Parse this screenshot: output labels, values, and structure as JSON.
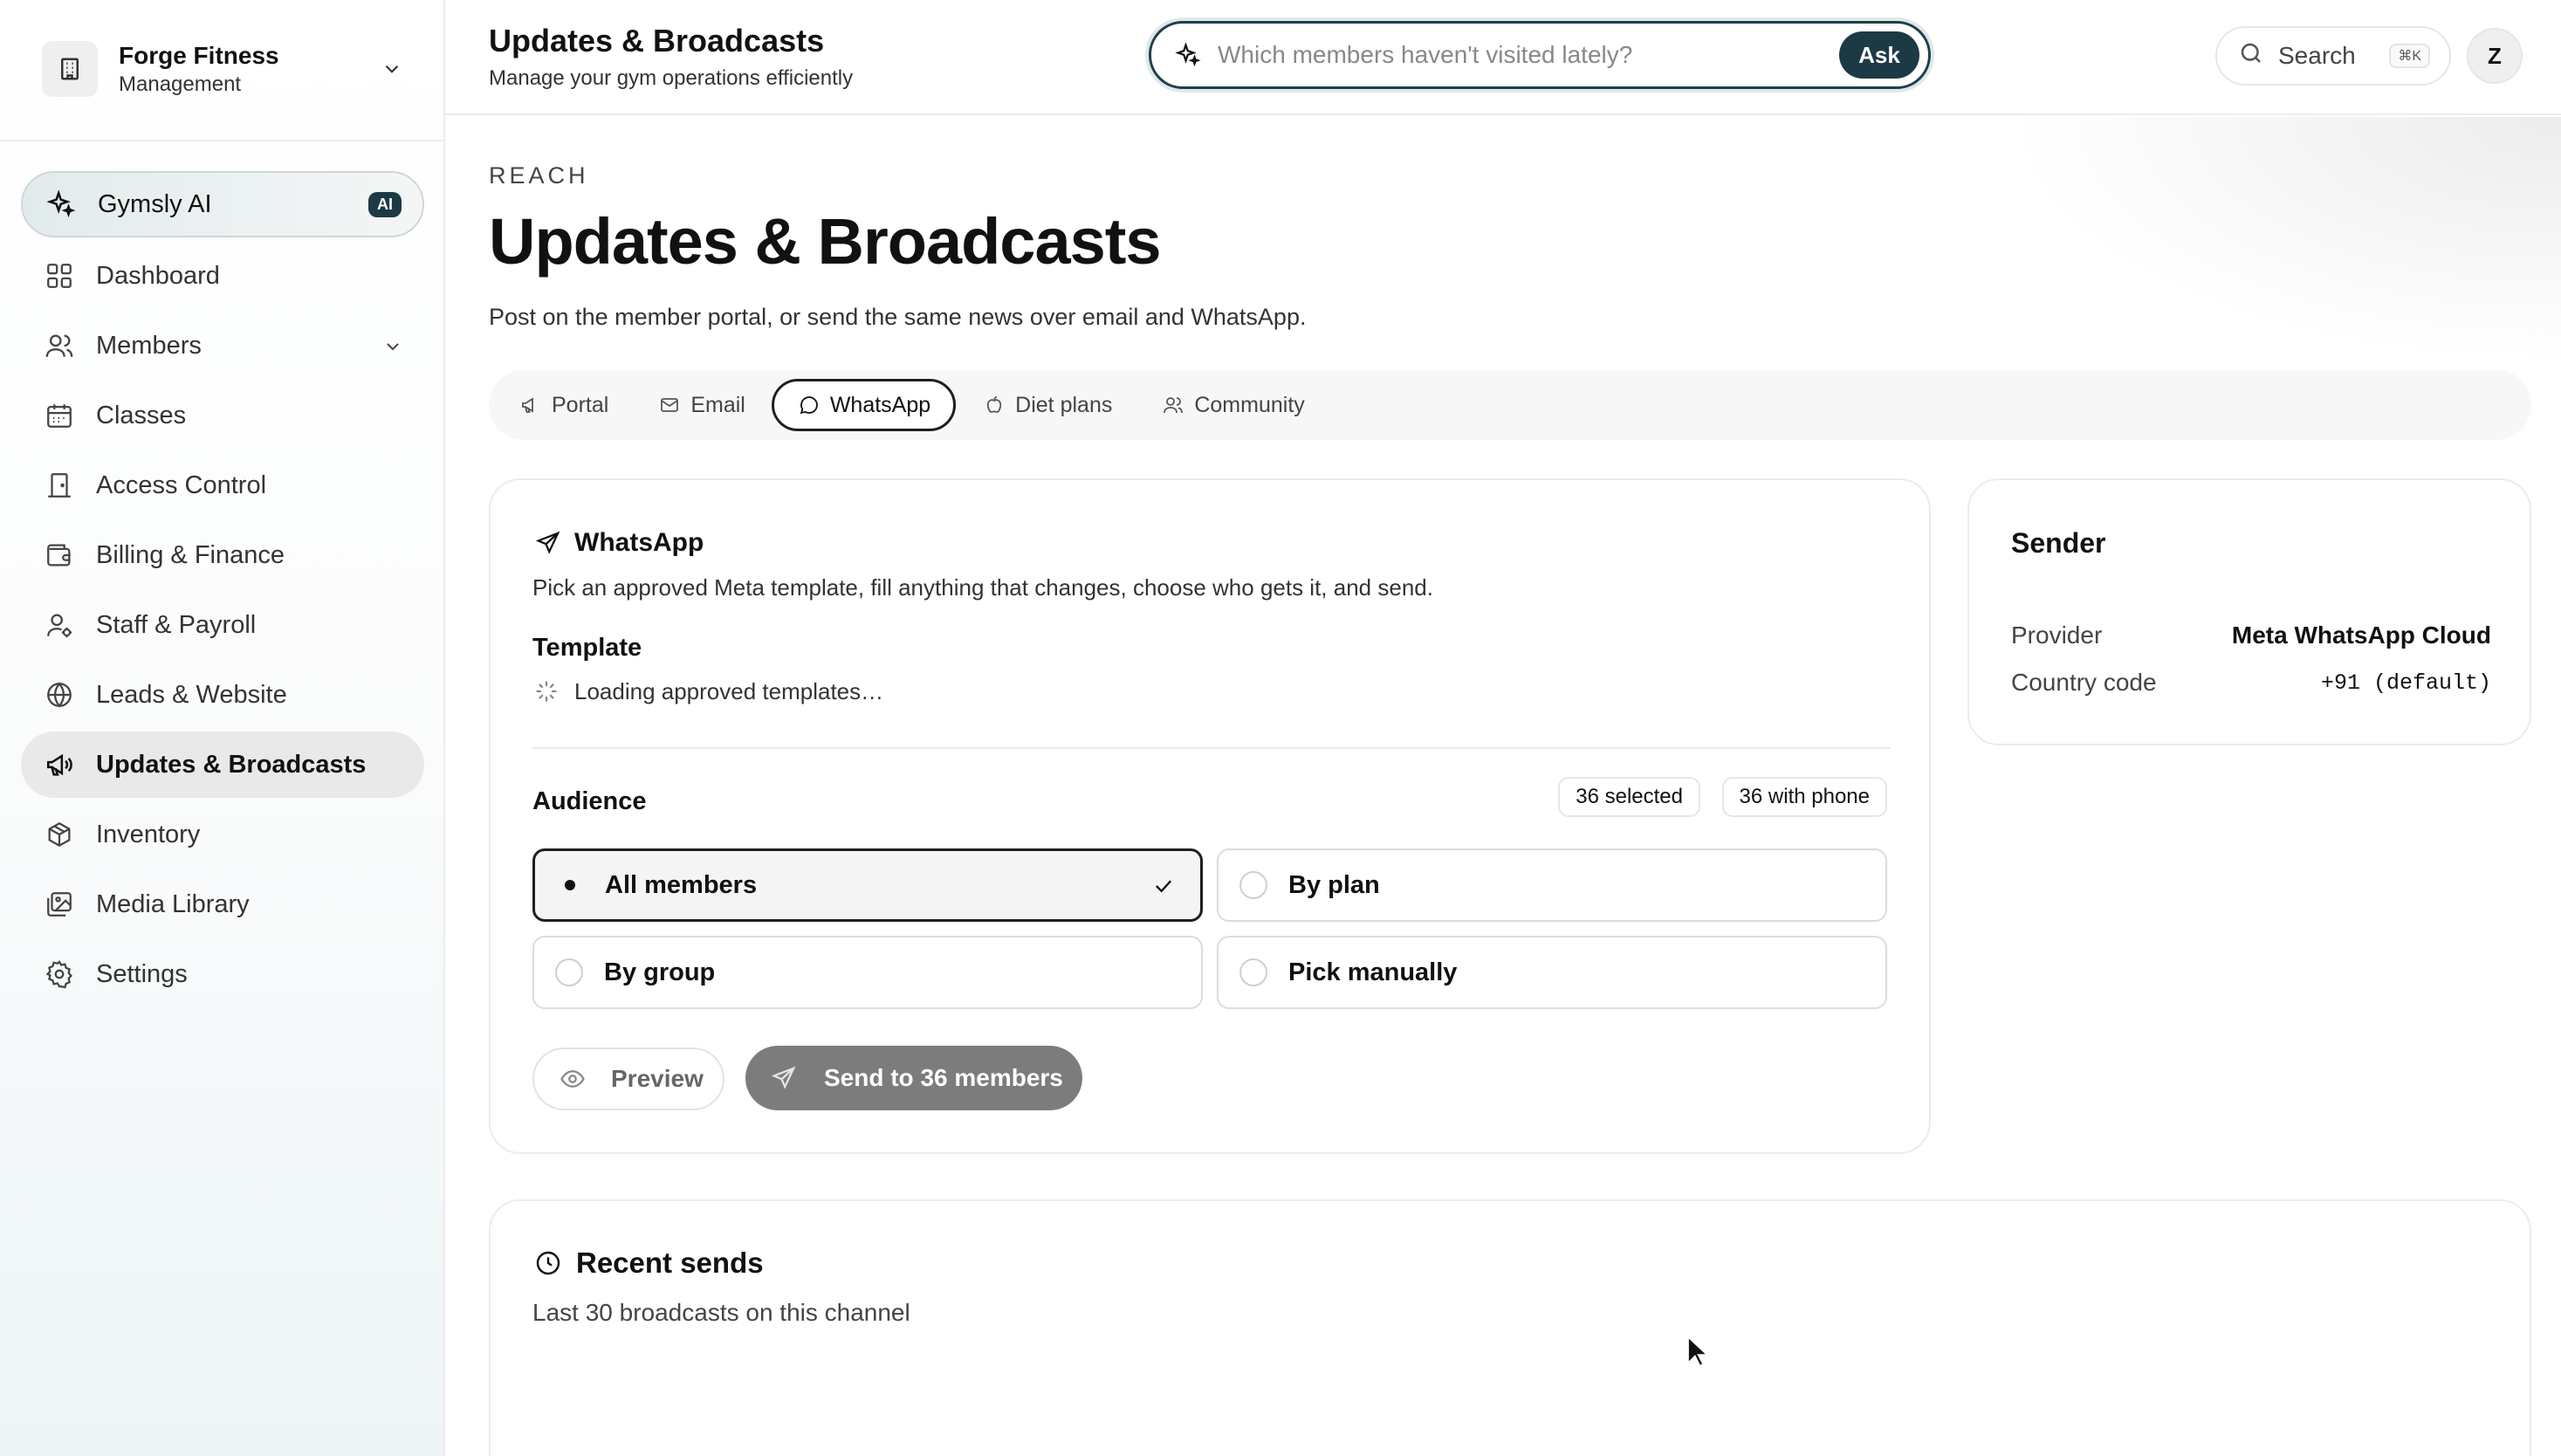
{
  "sidebar": {
    "org_name": "Forge Fitness",
    "org_sub": "Management",
    "items": [
      {
        "label": "Gymsly AI",
        "icon": "sparkles-icon",
        "badge": "AI"
      },
      {
        "label": "Dashboard",
        "icon": "grid-icon"
      },
      {
        "label": "Members",
        "icon": "users-icon"
      },
      {
        "label": "Classes",
        "icon": "calendar-icon"
      },
      {
        "label": "Access Control",
        "icon": "door-icon"
      },
      {
        "label": "Billing & Finance",
        "icon": "wallet-icon"
      },
      {
        "label": "Staff & Payroll",
        "icon": "user-cog-icon"
      },
      {
        "label": "Leads & Website",
        "icon": "globe-icon"
      },
      {
        "label": "Updates & Broadcasts",
        "icon": "megaphone-icon"
      },
      {
        "label": "Inventory",
        "icon": "package-icon"
      },
      {
        "label": "Media Library",
        "icon": "images-icon"
      },
      {
        "label": "Settings",
        "icon": "gear-icon"
      }
    ]
  },
  "header": {
    "title": "Updates & Broadcasts",
    "subtitle": "Manage your gym operations efficiently",
    "ask_placeholder": "Which members haven't visited lately?",
    "ask_button": "Ask",
    "search_label": "Search",
    "search_shortcut": "⌘K",
    "avatar_initial": "Z"
  },
  "page": {
    "eyebrow": "REACH",
    "title": "Updates & Broadcasts",
    "description": "Post on the member portal, or send the same news over email and WhatsApp."
  },
  "tabs": [
    {
      "label": "Portal",
      "icon": "megaphone-icon"
    },
    {
      "label": "Email",
      "icon": "mail-icon"
    },
    {
      "label": "WhatsApp",
      "icon": "message-circle-icon",
      "active": true
    },
    {
      "label": "Diet plans",
      "icon": "apple-icon"
    },
    {
      "label": "Community",
      "icon": "users-icon"
    }
  ],
  "whatsapp": {
    "title": "WhatsApp",
    "description": "Pick an approved Meta template, fill anything that changes, choose who gets it, and send.",
    "template_label": "Template",
    "template_loading": "Loading approved templates…",
    "audience_label": "Audience",
    "selected_count": "36 selected",
    "with_phone_count": "36 with phone",
    "options": {
      "all_members": "All members",
      "by_plan": "By plan",
      "by_group": "By group",
      "pick_manually": "Pick manually"
    },
    "selected_option": "All members",
    "preview_button": "Preview",
    "send_button": "Send to 36 members"
  },
  "sender": {
    "title": "Sender",
    "provider_key": "Provider",
    "provider_value": "Meta WhatsApp Cloud",
    "country_key": "Country code",
    "country_value": "+91 (default)"
  },
  "recent": {
    "title": "Recent sends",
    "description": "Last 30 broadcasts on this channel"
  },
  "colors": {
    "accent_dark": "#1c3a45",
    "active_nav_bg": "#e9e9e9",
    "send_button_disabled": "#7c7c7c"
  }
}
